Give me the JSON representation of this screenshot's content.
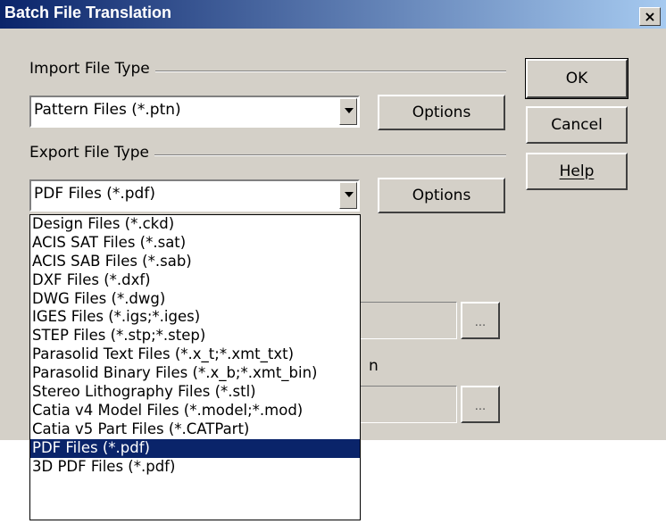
{
  "window": {
    "title": "Batch File Translation",
    "close_label": "×"
  },
  "buttons": {
    "ok": "OK",
    "cancel": "Cancel",
    "help": "Help"
  },
  "import": {
    "group_label": "Import File Type",
    "selected": "Pattern Files (*.ptn)",
    "options_label": "Options"
  },
  "export": {
    "group_label": "Export File Type",
    "selected": "PDF Files (*.pdf)",
    "options_label": "Options",
    "options": [
      "Design Files (*.ckd)",
      "ACIS SAT Files (*.sat)",
      "ACIS SAB Files (*.sab)",
      "DXF Files (*.dxf)",
      "DWG Files (*.dwg)",
      "IGES Files (*.igs;*.iges)",
      "STEP Files (*.stp;*.step)",
      "Parasolid Text Files (*.x_t;*.xmt_txt)",
      "Parasolid Binary Files (*.x_b;*.xmt_bin)",
      "Stereo Lithography Files (*.stl)",
      "Catia v4 Model Files (*.model;*.mod)",
      "Catia v5 Part Files (*.CATPart)",
      "PDF Files (*.pdf)",
      "3D PDF Files (*.pdf)"
    ],
    "highlighted_index": 12
  },
  "browse_label": "...",
  "partial_label": "n"
}
